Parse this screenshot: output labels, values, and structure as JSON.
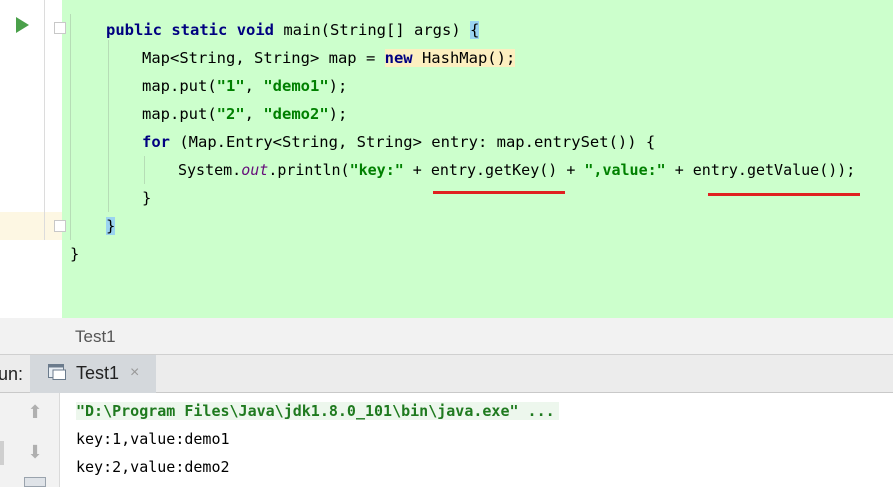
{
  "editor": {
    "code_lines": {
      "l1": {
        "kw1": "public",
        "kw2": "static",
        "kw3": "void",
        "rest": " main(String[] args) ",
        "brace": "{"
      },
      "l2": {
        "pre": "Map<String, String> map = ",
        "kw": "new",
        "rest": " HashMap();"
      },
      "l3": {
        "pre": "map.put(",
        "s1": "\"1\"",
        "mid": ", ",
        "s2": "\"demo1\"",
        "post": ");"
      },
      "l4": {
        "pre": "map.put(",
        "s1": "\"2\"",
        "mid": ", ",
        "s2": "\"demo2\"",
        "post": ");"
      },
      "l5": {
        "kw": "for",
        "rest": " (Map.Entry<String, String> entry: map.entrySet()) {"
      },
      "l6": {
        "pre": "System.",
        "field": "out",
        "mid": ".println(",
        "s1": "\"key:\"",
        "a": " + entry.getKey() + ",
        "s2": "\",value:\"",
        "b": " + entry.getValue());"
      },
      "l7": {
        "text": "}"
      },
      "l8": {
        "text": "}"
      },
      "l9": {
        "text": "}"
      }
    }
  },
  "file_tab": {
    "label": "Test1"
  },
  "run_panel": {
    "label": "un:",
    "tab_label": "Test1",
    "close_glyph": "×",
    "tools": {
      "up": "⬆",
      "down": "⬇"
    }
  },
  "console": {
    "command": "\"D:\\Program Files\\Java\\jdk1.8.0_101\\bin\\java.exe\" ...",
    "output": [
      "key:1,value:demo1",
      "key:2,value:demo2"
    ]
  },
  "colors": {
    "run_icon": "#4aa04a",
    "underline": "#e02020",
    "highlight_bg": "#ccffcc"
  }
}
